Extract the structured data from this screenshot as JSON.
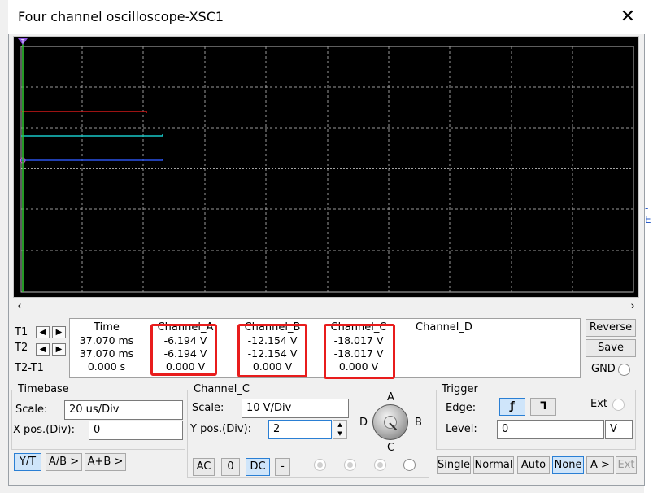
{
  "window": {
    "title": "Four channel oscilloscope-XSC1",
    "close_glyph": "✕"
  },
  "background": {
    "edge_mark": "-E"
  },
  "screen": {
    "cursor_marker": "T",
    "colors": {
      "bg": "#000000",
      "grid": "#bdbdbd",
      "channel_a": "#d01818",
      "channel_b": "#18c8c8",
      "channel_c": "#2a52e8",
      "channel_d": "#ffffff",
      "cursor": "#33cc33"
    }
  },
  "scroll": {
    "left_arrow": "‹",
    "right_arrow": "›"
  },
  "cursors": {
    "row_labels": [
      "T1",
      "T2",
      "T2-T1"
    ],
    "columns": {
      "time": {
        "header": "Time",
        "values": [
          "37.070 ms",
          "37.070 ms",
          "0.000 s"
        ]
      },
      "channel_a": {
        "header": "Channel_A",
        "values": [
          "-6.194 V",
          "-6.194 V",
          "0.000 V"
        ]
      },
      "channel_b": {
        "header": "Channel_B",
        "values": [
          "-12.154 V",
          "-12.154 V",
          "0.000 V"
        ]
      },
      "channel_c": {
        "header": "Channel_C",
        "values": [
          "-18.017 V",
          "-18.017 V",
          "0.000 V"
        ]
      },
      "channel_d": {
        "header": "Channel_D",
        "values": [
          "",
          "",
          ""
        ]
      }
    }
  },
  "side_buttons": {
    "reverse": "Reverse",
    "save": "Save",
    "gnd": "GND"
  },
  "timebase": {
    "label": "Timebase",
    "scale_label": "Scale:",
    "scale_value": "20 us/Div",
    "xpos_label": "X pos.(Div):",
    "xpos_value": "0",
    "modes": [
      "Y/T",
      "A/B >",
      "A+B >"
    ]
  },
  "channel": {
    "label": "Channel_C",
    "scale_label": "Scale:",
    "scale_value": "10  V/Div",
    "ypos_label": "Y pos.(Div):",
    "ypos_value": "2",
    "coupling": [
      "AC",
      "0",
      "DC",
      "-"
    ],
    "selector": {
      "a": "A",
      "b": "B",
      "c": "C",
      "d": "D"
    }
  },
  "trigger": {
    "label": "Trigger",
    "edge_label": "Edge:",
    "ext_label": "Ext",
    "level_label": "Level:",
    "level_value": "0",
    "level_unit": "V",
    "modes": [
      "Single",
      "Normal",
      "Auto",
      "None",
      "A >",
      "Ext"
    ]
  }
}
